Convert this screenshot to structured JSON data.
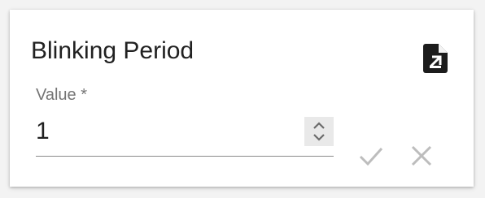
{
  "dialog": {
    "title": "Blinking Period"
  },
  "field": {
    "label": "Value *",
    "value": "1"
  },
  "icons": {
    "header_action": "file-export-icon",
    "spinner": "unfold-more-icon",
    "confirm": "check-icon",
    "cancel": "close-icon"
  },
  "colors": {
    "title_text": "#212121",
    "label_text": "#757575",
    "disabled_icon": "#bdbdbd",
    "spinner_bg": "#e9e9e9"
  }
}
